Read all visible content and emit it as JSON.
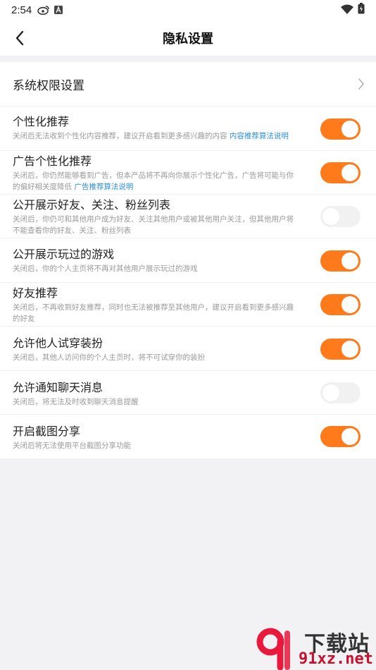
{
  "status": {
    "time": "2:54"
  },
  "header": {
    "title": "隐私设置"
  },
  "system_row": {
    "label": "系统权限设置"
  },
  "toggles": [
    {
      "label": "个性化推荐",
      "desc": "关闭后无法收到个性化内容推荐，建议开启看到更多感兴趣的内容 ",
      "link": "内容推荐算法说明",
      "on": true
    },
    {
      "label": "广告个性化推荐",
      "desc": "关闭后，你仍然能够看到广告，但本产品将不再向你展示个性化广告，广告将可能与你的偏好相关度降低 ",
      "link": "广告推荐算法说明",
      "on": true
    },
    {
      "label": "公开展示好友、关注、粉丝列表",
      "desc": "关闭后，你仍可和其他用户成为好友、关注其他用户或被其他用户关注，但其他用户将不能查看你的好友、关注、粉丝列表",
      "link": "",
      "on": false
    },
    {
      "label": "公开展示玩过的游戏",
      "desc": "关闭后，你的个人主页将不再对其他用户展示玩过的游戏",
      "link": "",
      "on": true
    },
    {
      "label": "好友推荐",
      "desc": "关闭后，不再收到好友推荐，同时也无法被推荐至其他用户，建议开启看到更多感兴趣的好友",
      "link": "",
      "on": true
    },
    {
      "label": "允许他人试穿装扮",
      "desc": "关闭后，其他人访问你的个人主页时，将不可试穿你的装扮",
      "link": "",
      "on": true
    },
    {
      "label": "允许通知聊天消息",
      "desc": "关闭后，将无法及时收到聊天消息提醒",
      "link": "",
      "on": false
    },
    {
      "label": "开启截图分享",
      "desc": "关闭后将无法使用平台截图分享功能",
      "link": "",
      "on": true
    }
  ],
  "watermark": {
    "line1": "下载站",
    "line2": "91xz.net"
  },
  "colors": {
    "accent": "#ff7a1a",
    "link": "#2a8fdf",
    "switch_off": "#f1f1f1"
  }
}
